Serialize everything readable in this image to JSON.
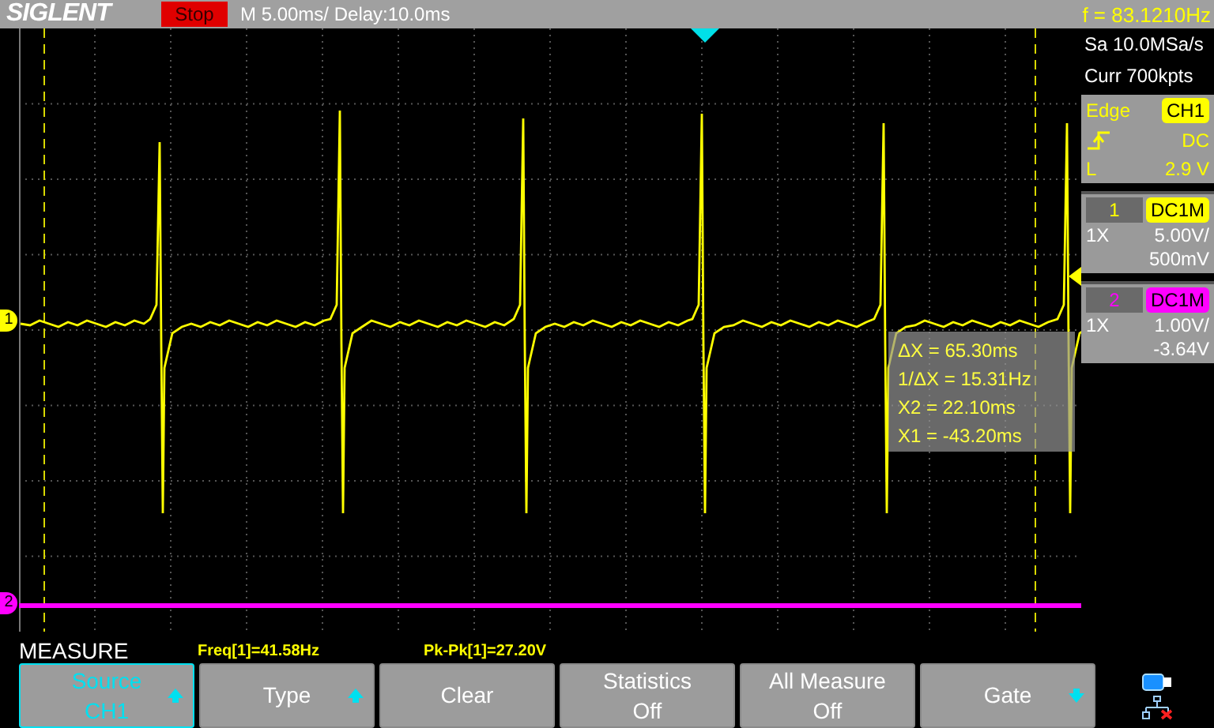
{
  "header": {
    "brand": "SIGLENT",
    "run_state": "Stop",
    "timebase": "M 5.00ms/ Delay:10.0ms",
    "frequency": "f = 83.1210Hz"
  },
  "acquisition": {
    "sample_rate": "Sa 10.0MSa/s",
    "memory": "Curr 700kpts"
  },
  "trigger": {
    "type": "Edge",
    "source": "CH1",
    "coupling": "DC",
    "level_label": "L",
    "level_value": "2.9 V"
  },
  "channels": [
    {
      "number": "1",
      "coupling": "DC1M",
      "probe": "1X",
      "scale": "5.00V/",
      "offset": "500mV",
      "color": "#ffff00"
    },
    {
      "number": "2",
      "coupling": "DC1M",
      "probe": "1X",
      "scale": "1.00V/",
      "offset": "-3.64V",
      "color": "#ff00ff"
    }
  ],
  "plot": {
    "channel_markers": [
      {
        "label": "1",
        "color": "#ffff00"
      },
      {
        "label": "2",
        "color": "#ff00ff"
      }
    ],
    "cursor_readout": [
      "ΔX = 65.30ms",
      "1/ΔX = 15.31Hz",
      "X2 = 22.10ms",
      "X1 = -43.20ms"
    ]
  },
  "measure": {
    "title": "MEASURE",
    "readings": [
      "Freq[1]=41.58Hz",
      "Pk-Pk[1]=27.20V"
    ]
  },
  "softkeys": [
    {
      "kind": "up",
      "label": "Source",
      "value": "CH1",
      "selected": true
    },
    {
      "kind": "up",
      "label": "Type",
      "selected": false
    },
    {
      "kind": "plain",
      "label": "Clear",
      "selected": false
    },
    {
      "kind": "plain",
      "label": "Statistics",
      "value": "Off",
      "selected": false
    },
    {
      "kind": "plain",
      "label": "All Measure",
      "value": "Off",
      "selected": false
    },
    {
      "kind": "down",
      "label": "Gate",
      "selected": false
    }
  ]
}
